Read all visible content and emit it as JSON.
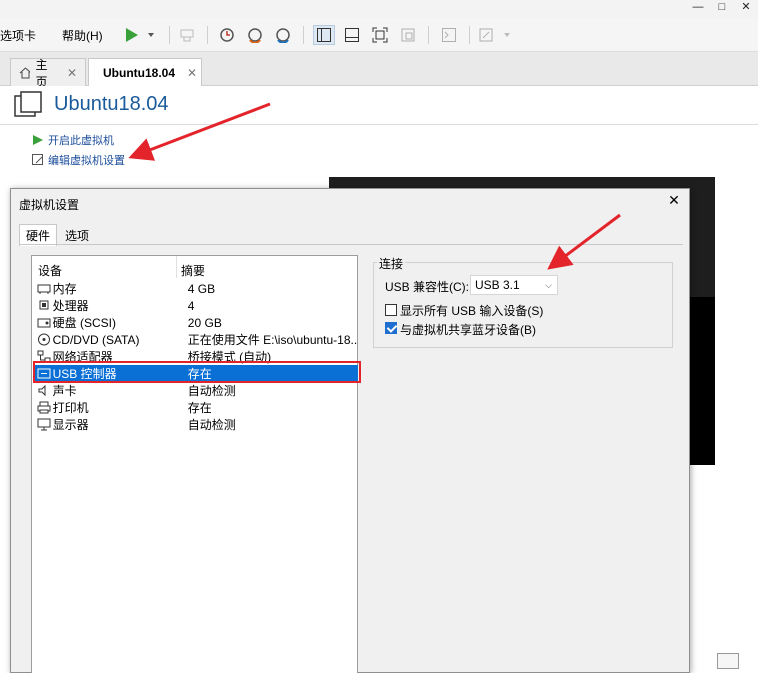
{
  "window": {
    "minimize": "—",
    "maximize": "□",
    "close": "✕"
  },
  "menu": {
    "items": [
      "选项卡",
      "帮助(H)"
    ]
  },
  "tabs": [
    {
      "label": "主页",
      "close": "✕"
    },
    {
      "label": "Ubuntu18.04",
      "close": "✕"
    }
  ],
  "vm": {
    "title": "Ubuntu18.04",
    "actions": [
      "开启此虚拟机",
      "编辑虚拟机设置"
    ]
  },
  "dialog": {
    "title": "虚拟机设置",
    "close": "✕",
    "tabs": [
      "硬件",
      "选项"
    ],
    "columns": {
      "device": "设备",
      "summary": "摘要"
    },
    "devices": [
      {
        "name": "内存",
        "summary": "4 GB",
        "icon": "memory-icon"
      },
      {
        "name": "处理器",
        "summary": "4",
        "icon": "cpu-icon"
      },
      {
        "name": "硬盘 (SCSI)",
        "summary": "20 GB",
        "icon": "harddisk-icon"
      },
      {
        "name": "CD/DVD (SATA)",
        "summary": "正在使用文件 E:\\iso\\ubuntu-18....",
        "icon": "cd-icon"
      },
      {
        "name": "网络适配器",
        "summary": "桥接模式 (自动)",
        "icon": "network-icon"
      },
      {
        "name": "USB 控制器",
        "summary": "存在",
        "icon": "usb-icon",
        "selected": true
      },
      {
        "name": "声卡",
        "summary": "自动检测",
        "icon": "sound-icon"
      },
      {
        "name": "打印机",
        "summary": "存在",
        "icon": "printer-icon"
      },
      {
        "name": "显示器",
        "summary": "自动检测",
        "icon": "display-icon"
      }
    ],
    "connection": {
      "group_label": "连接",
      "compat_label": "USB 兼容性(C):",
      "compat_value": "USB 3.1",
      "show_all_label": "显示所有 USB 输入设备(S)",
      "show_all_checked": false,
      "bluetooth_label": "与虚拟机共享蓝牙设备(B)",
      "bluetooth_checked": true
    }
  },
  "colors": {
    "accent": "#0a70d6",
    "highlight_box": "#e3242b",
    "annotation_arrow": "#e3242b",
    "play": "#3aa13a"
  }
}
